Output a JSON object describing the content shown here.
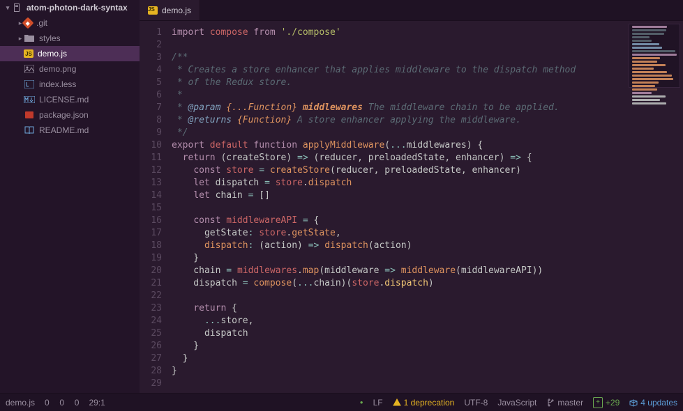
{
  "sidebar": {
    "project": "atom-photon-dark-syntax",
    "items": [
      {
        "label": ".git",
        "icon": "git",
        "depth": 1,
        "expandable": true
      },
      {
        "label": "styles",
        "icon": "folder",
        "depth": 1,
        "expandable": true
      },
      {
        "label": "demo.js",
        "icon": "js",
        "depth": 1,
        "selected": true
      },
      {
        "label": "demo.png",
        "icon": "img",
        "depth": 1
      },
      {
        "label": "index.less",
        "icon": "less",
        "depth": 1
      },
      {
        "label": "LICENSE.md",
        "icon": "md",
        "depth": 1
      },
      {
        "label": "package.json",
        "icon": "json",
        "depth": 1
      },
      {
        "label": "README.md",
        "icon": "readme",
        "depth": 1
      }
    ]
  },
  "tabs": [
    {
      "label": "demo.js",
      "icon": "js",
      "active": true
    }
  ],
  "code": {
    "lines": [
      [
        {
          "t": "import ",
          "c": "kw"
        },
        {
          "t": "compose ",
          "c": "ident"
        },
        {
          "t": "from ",
          "c": "kw"
        },
        {
          "t": "'./compose'",
          "c": "str"
        }
      ],
      [],
      [
        {
          "t": "/**",
          "c": "cmt"
        }
      ],
      [
        {
          "t": " * Creates a store enhancer that applies middleware to the dispatch method",
          "c": "cmt"
        }
      ],
      [
        {
          "t": " * of the Redux store.",
          "c": "cmt"
        }
      ],
      [
        {
          "t": " *",
          "c": "cmt"
        }
      ],
      [
        {
          "t": " * ",
          "c": "cmt"
        },
        {
          "t": "@param ",
          "c": "doc-tag"
        },
        {
          "t": "{...Function} ",
          "c": "doc-type"
        },
        {
          "t": "middlewares ",
          "c": "doc-param"
        },
        {
          "t": "The middleware chain to be applied.",
          "c": "cmt-i"
        }
      ],
      [
        {
          "t": " * ",
          "c": "cmt"
        },
        {
          "t": "@returns ",
          "c": "doc-tag"
        },
        {
          "t": "{Function} ",
          "c": "doc-type"
        },
        {
          "t": "A store enhancer applying the middleware.",
          "c": "cmt-i"
        }
      ],
      [
        {
          "t": " */",
          "c": "cmt"
        }
      ],
      [
        {
          "t": "export ",
          "c": "kw"
        },
        {
          "t": "default ",
          "c": "ident"
        },
        {
          "t": "function ",
          "c": "kw"
        },
        {
          "t": "applyMiddleware",
          "c": "fn"
        },
        {
          "t": "(",
          "c": "punc"
        },
        {
          "t": "...",
          "c": "spread"
        },
        {
          "t": "middlewares",
          "c": "punc"
        },
        {
          "t": ") {",
          "c": "punc"
        }
      ],
      [
        {
          "t": "  ",
          "c": ""
        },
        {
          "t": "return ",
          "c": "kw"
        },
        {
          "t": "(createStore) ",
          "c": "punc"
        },
        {
          "t": "=> ",
          "c": "op"
        },
        {
          "t": "(reducer, preloadedState, enhancer) ",
          "c": "punc"
        },
        {
          "t": "=> ",
          "c": "op"
        },
        {
          "t": "{",
          "c": "punc"
        }
      ],
      [
        {
          "t": "    ",
          "c": ""
        },
        {
          "t": "const ",
          "c": "kw"
        },
        {
          "t": "store ",
          "c": "ident"
        },
        {
          "t": "= ",
          "c": "op"
        },
        {
          "t": "createStore",
          "c": "fn"
        },
        {
          "t": "(reducer, preloadedState, enhancer)",
          "c": "punc"
        }
      ],
      [
        {
          "t": "    ",
          "c": ""
        },
        {
          "t": "let ",
          "c": "kw"
        },
        {
          "t": "dispatch ",
          "c": "punc"
        },
        {
          "t": "= ",
          "c": "op"
        },
        {
          "t": "store",
          "c": "ident"
        },
        {
          "t": ".",
          "c": "punc"
        },
        {
          "t": "dispatch",
          "c": "fn"
        }
      ],
      [
        {
          "t": "    ",
          "c": ""
        },
        {
          "t": "let ",
          "c": "kw"
        },
        {
          "t": "chain ",
          "c": "punc"
        },
        {
          "t": "= ",
          "c": "op"
        },
        {
          "t": "[]",
          "c": "punc"
        }
      ],
      [],
      [
        {
          "t": "    ",
          "c": ""
        },
        {
          "t": "const ",
          "c": "kw"
        },
        {
          "t": "middlewareAPI ",
          "c": "ident"
        },
        {
          "t": "= ",
          "c": "op"
        },
        {
          "t": "{",
          "c": "punc"
        }
      ],
      [
        {
          "t": "      getState",
          "c": "punc"
        },
        {
          "t": ": ",
          "c": "op"
        },
        {
          "t": "store",
          "c": "ident"
        },
        {
          "t": ".",
          "c": "punc"
        },
        {
          "t": "getState",
          "c": "fn"
        },
        {
          "t": ",",
          "c": "punc"
        }
      ],
      [
        {
          "t": "      ",
          "c": ""
        },
        {
          "t": "dispatch",
          "c": "fn"
        },
        {
          "t": ": ",
          "c": "op"
        },
        {
          "t": "(action) ",
          "c": "punc"
        },
        {
          "t": "=> ",
          "c": "op"
        },
        {
          "t": "dispatch",
          "c": "fn"
        },
        {
          "t": "(action)",
          "c": "punc"
        }
      ],
      [
        {
          "t": "    }",
          "c": "punc"
        }
      ],
      [
        {
          "t": "    chain ",
          "c": "punc"
        },
        {
          "t": "= ",
          "c": "op"
        },
        {
          "t": "middlewares",
          "c": "ident"
        },
        {
          "t": ".",
          "c": "punc"
        },
        {
          "t": "map",
          "c": "fn"
        },
        {
          "t": "(middleware ",
          "c": "punc"
        },
        {
          "t": "=> ",
          "c": "op"
        },
        {
          "t": "middleware",
          "c": "fn"
        },
        {
          "t": "(middlewareAPI))",
          "c": "punc"
        }
      ],
      [
        {
          "t": "    dispatch ",
          "c": "punc"
        },
        {
          "t": "= ",
          "c": "op"
        },
        {
          "t": "compose",
          "c": "fn"
        },
        {
          "t": "(",
          "c": "punc"
        },
        {
          "t": "...",
          "c": "spread"
        },
        {
          "t": "chain)(",
          "c": "punc"
        },
        {
          "t": "store",
          "c": "ident"
        },
        {
          "t": ".",
          "c": "punc"
        },
        {
          "t": "dispatch",
          "c": "prop"
        },
        {
          "t": ")",
          "c": "punc"
        }
      ],
      [],
      [
        {
          "t": "    ",
          "c": ""
        },
        {
          "t": "return ",
          "c": "kw"
        },
        {
          "t": "{",
          "c": "punc"
        }
      ],
      [
        {
          "t": "      ",
          "c": ""
        },
        {
          "t": "...",
          "c": "spread"
        },
        {
          "t": "store,",
          "c": "punc"
        }
      ],
      [
        {
          "t": "      dispatch",
          "c": "punc"
        }
      ],
      [
        {
          "t": "    }",
          "c": "punc"
        }
      ],
      [
        {
          "t": "  }",
          "c": "punc"
        }
      ],
      [
        {
          "t": "}",
          "c": "punc"
        }
      ],
      []
    ]
  },
  "status": {
    "file": "demo.js",
    "diagnostics": [
      "0",
      "0",
      "0"
    ],
    "cursor": "29:1",
    "line_ending": "LF",
    "deprecation": "1 deprecation",
    "encoding": "UTF-8",
    "language": "JavaScript",
    "branch": "master",
    "git_diff": "+29",
    "updates": "4 updates"
  },
  "minimap_colors": [
    "#b48ead",
    "#5b6b74",
    "#5b6b74",
    "#5b6b74",
    "#5b6b74",
    "#81a2be",
    "#81a2be",
    "#5b6b74",
    "#b48ead",
    "#de935f",
    "#de935f",
    "#de935f",
    "#de935f",
    "#de935f",
    "#de935f",
    "#de935f",
    "#de935f",
    "#de935f",
    "#de935f",
    "#b48ead",
    "#c5c8c6",
    "#c5c8c6",
    "#c5c8c6"
  ]
}
